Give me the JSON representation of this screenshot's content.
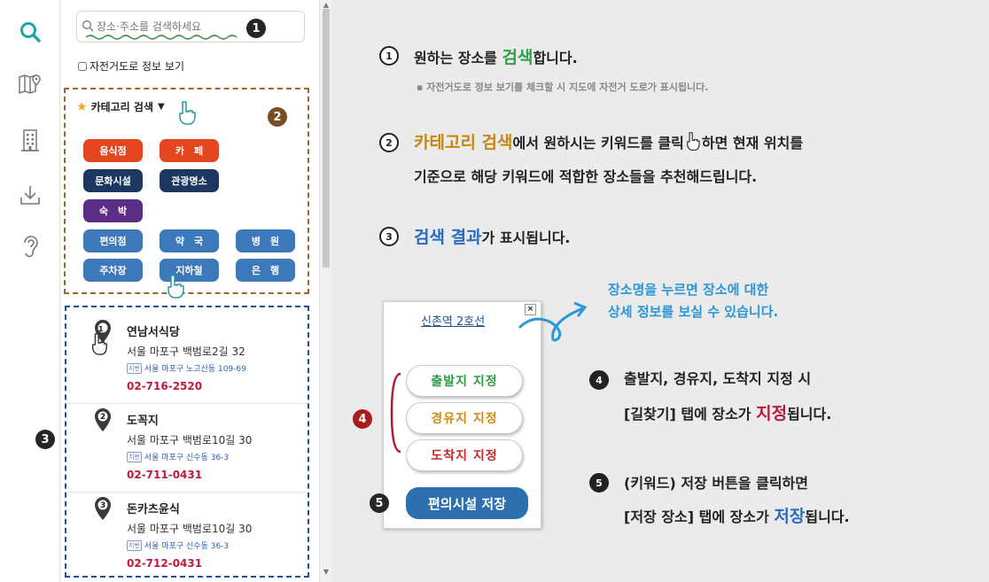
{
  "colors": {
    "accent": "#2aa3a3",
    "category_border": "#9b6a28",
    "result_border": "#1e4fa0",
    "save_button": "#2e6faf",
    "phone": "#c0193a"
  },
  "rail": {
    "icons": [
      "search-icon",
      "map-icon",
      "building-icon",
      "download-icon",
      "ear-icon"
    ]
  },
  "search": {
    "placeholder": "장소·주소를 검색하세요",
    "badge": "1"
  },
  "bike": {
    "label": "자전거도로 정보 보기"
  },
  "category": {
    "title": "카테고리 검색",
    "badge": "2",
    "items": [
      "음식점",
      "카　페",
      "문화시설",
      "관광명소",
      "숙　박",
      "편의점",
      "약　국",
      "병　원",
      "주차장",
      "지하철",
      "은　행"
    ]
  },
  "results": {
    "badge": "3",
    "items": [
      {
        "num": "1",
        "name": "연남서식당",
        "address": "서울 마포구 백범로2길 32",
        "jibun_tag": "지번",
        "jibun": "서울 마포구 노고산동 109-69",
        "phone": "02-716-2520"
      },
      {
        "num": "2",
        "name": "도꼭지",
        "address": "서울 마포구 백범로10길 30",
        "jibun_tag": "지번",
        "jibun": "서울 마포구 신수동 36-3",
        "phone": "02-711-0431"
      },
      {
        "num": "3",
        "name": "돈카츠윤식",
        "address": "서울 마포구 백범로10길 30",
        "jibun_tag": "지번",
        "jibun": "서울 마포구 신수동 36-3",
        "phone": "02-712-0431"
      }
    ]
  },
  "popup": {
    "title": "신촌역 2호선",
    "close": "×",
    "start": "출발지 지정",
    "via": "경유지 지정",
    "end": "도착지 지정",
    "save": "편의시설 저장",
    "badge4": "4",
    "badge5": "5"
  },
  "callout": {
    "line1": "장소명을 누르면 장소에 대한",
    "line2": "상세 정보를 보실 수 있습니다."
  },
  "instructions": {
    "i1": {
      "num": "1",
      "pre": "원하는 장소를 ",
      "hl": "검색",
      "post": "합니다.",
      "sub": "▪ 자전거도로 정보 보기를 체크할 시 지도에 자전거 도로가 표시됩니다."
    },
    "i2": {
      "num": "2",
      "hl": "카테고리 검색",
      "mid": "에서 원하시는 키워드를 클릭",
      "post": "하면 현재 위치를",
      "line2": "기준으로 해당 키워드에 적합한 장소들을 추천해드립니다."
    },
    "i3": {
      "num": "3",
      "hl": "검색 결과",
      "post": "가 표시됩니다."
    },
    "i4": {
      "num": "4",
      "line1": "출발지, 경유지, 도착지 지정 시",
      "pre2": "[길찾기] 탭에 장소가 ",
      "hl": "지정",
      "post2": "됩니다."
    },
    "i5": {
      "num": "5",
      "line1": "(키워드) 저장 버튼을 클릭하면",
      "pre2": "[저장 장소] 탭에 장소가 ",
      "hl": "저장",
      "post2": "됩니다."
    }
  }
}
